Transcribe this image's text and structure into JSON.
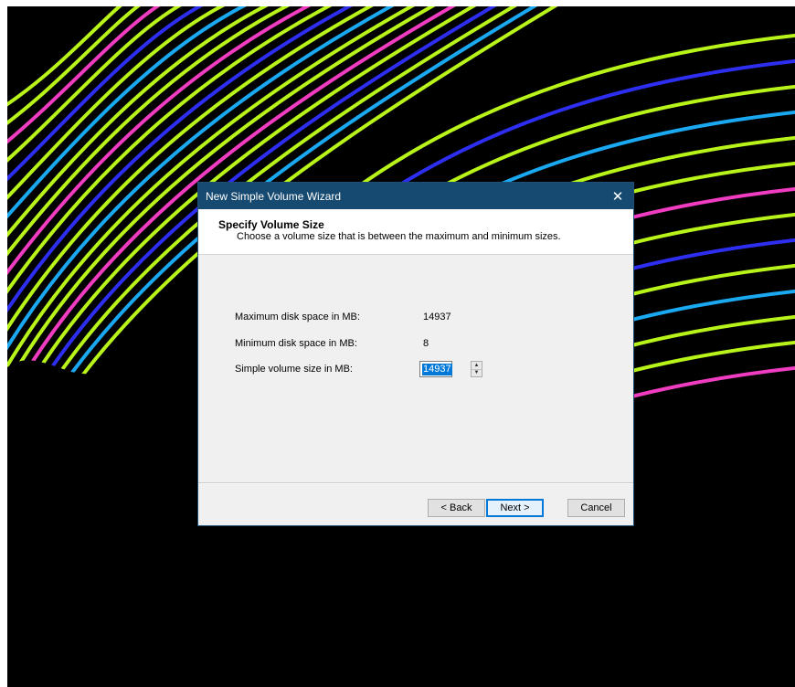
{
  "window": {
    "title": "New Simple Volume Wizard",
    "close_glyph": "✕"
  },
  "header": {
    "title": "Specify Volume Size",
    "description": "Choose a volume size that is between the maximum and minimum sizes."
  },
  "fields": {
    "max_label": "Maximum disk space in MB:",
    "max_value": "14937",
    "min_label": "Minimum disk space in MB:",
    "min_value": "8",
    "size_label": "Simple volume size in MB:",
    "size_value": "14937"
  },
  "buttons": {
    "back": "< Back",
    "next": "Next >",
    "cancel": "Cancel"
  },
  "colors": {
    "titlebar": "#164a70",
    "selection": "#0078d7",
    "wallpaper_lime": "#b8f41a",
    "wallpaper_pink": "#f03cc0",
    "wallpaper_blue": "#2d2ef0",
    "wallpaper_cyan": "#1aa8f0"
  }
}
